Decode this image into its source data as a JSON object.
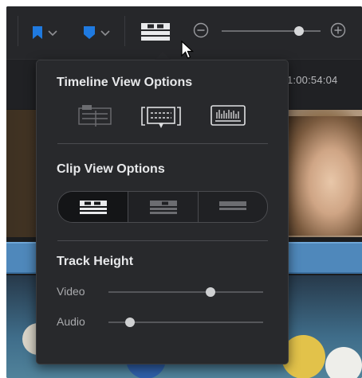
{
  "popup": {
    "timeline_view": {
      "title": "Timeline View Options",
      "icons": [
        "stacked-timelines-icon",
        "subtitle-tracks-icon",
        "audio-waveforms-icon"
      ]
    },
    "clip_view": {
      "title": "Clip View Options",
      "options": [
        "filmstrip-view-icon",
        "thumbnail-view-icon",
        "simple-view-icon"
      ],
      "selected_index": 0
    },
    "track_height": {
      "title": "Track Height",
      "video_label": "Video",
      "audio_label": "Audio",
      "video_level": 0.66,
      "audio_level": 0.14
    }
  },
  "timeline": {
    "timecode": "1:00:54:04"
  },
  "toolbar": {
    "zoom_level": 0.78
  },
  "colors": {
    "accent_blue": "#1f7ae0",
    "track_blue": "#4f88bb"
  }
}
